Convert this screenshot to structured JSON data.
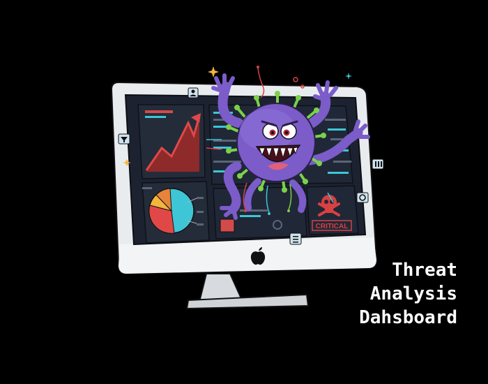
{
  "caption": {
    "line1": "Threat",
    "line2": "Analysis",
    "line3": "Dahsboard"
  },
  "screen": {
    "critical_label": "CRITICAL"
  },
  "icons": {
    "brand": "apple-logo-icon",
    "hazard": "skull-crossbones-icon",
    "trend": "rising-line-chart-icon",
    "share": "pie-chart-icon",
    "creature": "virus-monster-icon"
  },
  "colors": {
    "background": "#000000",
    "panel": "#1f2937",
    "trend_red": "#c0392b",
    "pie_cyan": "#3ec6d6",
    "pie_red": "#e04848",
    "pie_yellow": "#f2b63c",
    "virus_purple": "#7b5cc9",
    "virus_spike_green": "#7bd14a",
    "critical_red": "#d94040"
  }
}
